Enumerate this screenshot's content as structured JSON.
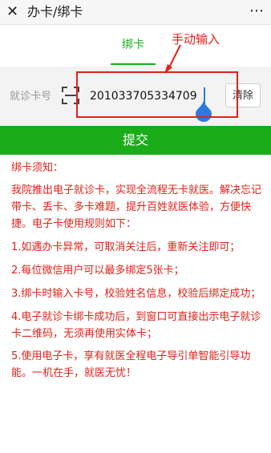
{
  "titlebar": {
    "close_symbol": "✕",
    "title": "办卡/绑卡",
    "more_symbol": "⋯"
  },
  "tabs": [
    {
      "label": "绑卡",
      "active": true
    }
  ],
  "annotation": {
    "text": "手动输入",
    "color": "#e0221a"
  },
  "card_form": {
    "label": "就诊卡号",
    "card_number": "201033705334709",
    "clear_label": "清除",
    "icon": "scan-icon"
  },
  "submit_label": "提交",
  "notice": {
    "title": "绑卡须知：",
    "paragraphs": [
      "我院推出电子就诊卡，实现全流程无卡就医。解决忘记带卡、丢卡、多卡难题，提升百姓就医体验，方便快捷。电子卡使用规则如下：",
      "1.如遇办卡异常，可取消关注后，重新关注即可；",
      "2.每位微信用户可以最多绑定5张卡；",
      "3.绑卡时输入卡号，校验姓名信息，校验后绑定成功；",
      "4.电子就诊卡绑卡成功后，到窗口可直接出示电子就诊卡二维码，无须再使用实体卡；",
      "5.使用电子卡，享有就医全程电子导引单智能引导功能。一机在手，就医无忧！"
    ]
  },
  "colors": {
    "accent": "#1aad19",
    "notice_text": "#e0221a"
  }
}
